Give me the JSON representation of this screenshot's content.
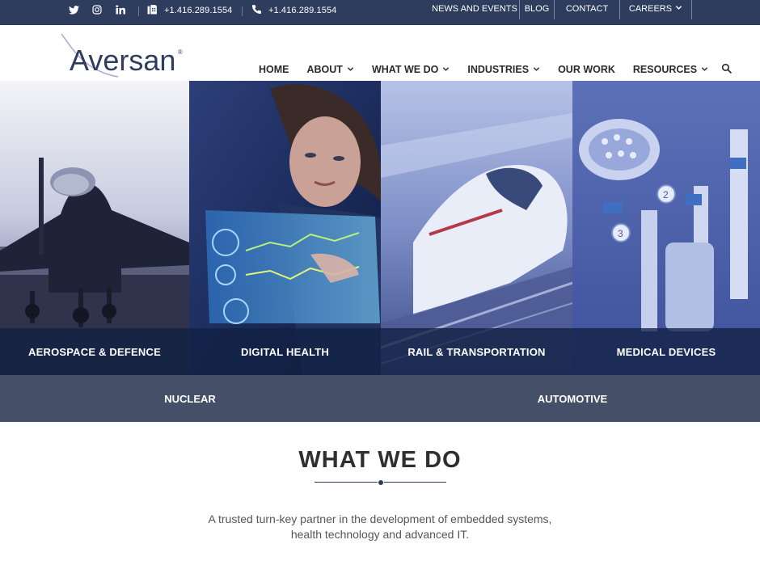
{
  "topbar": {
    "social": [
      "twitter-icon",
      "instagram-icon",
      "linkedin-icon"
    ],
    "fax": "+1.416.289.1554",
    "phone": "+1.416.289.1554",
    "links": {
      "news": "NEWS AND EVENTS",
      "blog": "BLOG",
      "contact": "CONTACT",
      "careers": "CAREERS"
    }
  },
  "brand": {
    "name": "Aversan",
    "mark": "®",
    "color": "#2e3d5e",
    "swoosh_color": "#b9a6d2"
  },
  "nav": {
    "home": "HOME",
    "about": "ABOUT",
    "what_we_do": "WHAT WE DO",
    "industries": "INDUSTRIES",
    "our_work": "OUR WORK",
    "resources": "RESOURCES"
  },
  "industries": {
    "aerospace": "AEROSPACE & DEFENCE",
    "digital_health": "DIGITAL HEALTH",
    "rail": "RAIL & TRANSPORTATION",
    "medical": "MEDICAL DEVICES",
    "nuclear": "NUCLEAR",
    "automotive": "AUTOMOTIVE"
  },
  "section": {
    "title": "WHAT WE DO",
    "tagline_line1": "A trusted turn-key partner in the development of embedded systems,",
    "tagline_line2": "health technology and advanced IT."
  }
}
